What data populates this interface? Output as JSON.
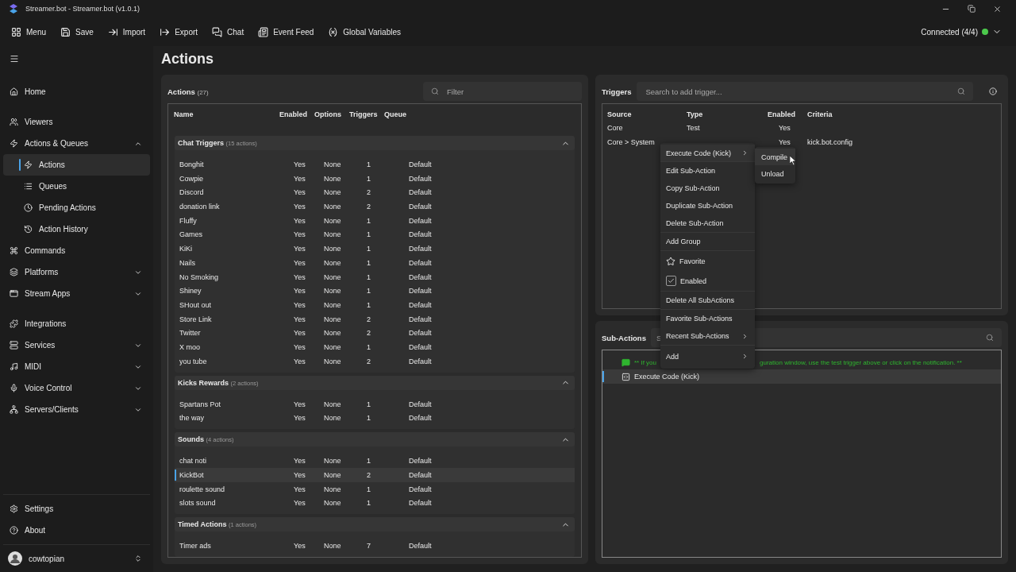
{
  "window": {
    "title": "Streamer.bot - Streamer.bot (v1.0.1)"
  },
  "toolbar": [
    {
      "label": "Menu"
    },
    {
      "label": "Save"
    },
    {
      "label": "Import"
    },
    {
      "label": "Export"
    },
    {
      "label": "Chat"
    },
    {
      "label": "Event Feed"
    },
    {
      "label": "Global Variables"
    }
  ],
  "connection": {
    "label": "Connected (4/4)",
    "connected": true
  },
  "sidebar": {
    "items": [
      {
        "label": "Home"
      },
      {
        "label": "Viewers"
      },
      {
        "label": "Actions & Queues",
        "expanded": true,
        "children": [
          {
            "label": "Actions",
            "selected": true
          },
          {
            "label": "Queues",
            "selected": false
          },
          {
            "label": "Pending Actions",
            "selected": false
          },
          {
            "label": "Action History",
            "selected": false
          }
        ]
      },
      {
        "label": "Commands"
      },
      {
        "label": "Platforms",
        "expanded": false
      },
      {
        "label": "Stream Apps",
        "expanded": false
      },
      {
        "label": "Integrations"
      },
      {
        "label": "Services",
        "expanded": false
      },
      {
        "label": "MIDI",
        "expanded": false
      },
      {
        "label": "Voice Control",
        "expanded": false
      },
      {
        "label": "Servers/Clients",
        "expanded": false
      }
    ],
    "bottom": [
      {
        "label": "Settings"
      },
      {
        "label": "About"
      }
    ],
    "user": {
      "name": "cowtopian"
    }
  },
  "page_title": "Actions",
  "actions_panel": {
    "title": "Actions",
    "count": "(27)",
    "filter_placeholder": "Filter",
    "columns": [
      "Name",
      "Enabled",
      "Options",
      "Triggers",
      "Queue"
    ],
    "groups": [
      {
        "name": "Chat Triggers",
        "count": "(15 actions)",
        "expanded": true,
        "rows": [
          {
            "name": "Bonghit",
            "enabled": "Yes",
            "options": "None",
            "triggers": "1",
            "queue": "Default",
            "selected": false
          },
          {
            "name": "Cowpie",
            "enabled": "Yes",
            "options": "None",
            "triggers": "1",
            "queue": "Default",
            "selected": false
          },
          {
            "name": "Discord",
            "enabled": "Yes",
            "options": "None",
            "triggers": "2",
            "queue": "Default",
            "selected": false
          },
          {
            "name": "donation link",
            "enabled": "Yes",
            "options": "None",
            "triggers": "2",
            "queue": "Default",
            "selected": false
          },
          {
            "name": "Fluffy",
            "enabled": "Yes",
            "options": "None",
            "triggers": "1",
            "queue": "Default",
            "selected": false
          },
          {
            "name": "Games",
            "enabled": "Yes",
            "options": "None",
            "triggers": "1",
            "queue": "Default",
            "selected": false
          },
          {
            "name": "KiKi",
            "enabled": "Yes",
            "options": "None",
            "triggers": "1",
            "queue": "Default",
            "selected": false
          },
          {
            "name": "Nails",
            "enabled": "Yes",
            "options": "None",
            "triggers": "1",
            "queue": "Default",
            "selected": false
          },
          {
            "name": "No Smoking",
            "enabled": "Yes",
            "options": "None",
            "triggers": "1",
            "queue": "Default",
            "selected": false
          },
          {
            "name": "Shiney",
            "enabled": "Yes",
            "options": "None",
            "triggers": "1",
            "queue": "Default",
            "selected": false
          },
          {
            "name": "SHout out",
            "enabled": "Yes",
            "options": "None",
            "triggers": "1",
            "queue": "Default",
            "selected": false
          },
          {
            "name": "Store Link",
            "enabled": "Yes",
            "options": "None",
            "triggers": "2",
            "queue": "Default",
            "selected": false
          },
          {
            "name": "Twitter",
            "enabled": "Yes",
            "options": "None",
            "triggers": "2",
            "queue": "Default",
            "selected": false
          },
          {
            "name": "X moo",
            "enabled": "Yes",
            "options": "None",
            "triggers": "1",
            "queue": "Default",
            "selected": false
          },
          {
            "name": "you tube",
            "enabled": "Yes",
            "options": "None",
            "triggers": "2",
            "queue": "Default",
            "selected": false
          }
        ]
      },
      {
        "name": "Kicks Rewards",
        "count": "(2 actions)",
        "expanded": true,
        "rows": [
          {
            "name": "Spartans Pot",
            "enabled": "Yes",
            "options": "None",
            "triggers": "1",
            "queue": "Default",
            "selected": false
          },
          {
            "name": "the way",
            "enabled": "Yes",
            "options": "None",
            "triggers": "1",
            "queue": "Default",
            "selected": false
          }
        ]
      },
      {
        "name": "Sounds",
        "count": "(4 actions)",
        "expanded": true,
        "rows": [
          {
            "name": "chat noti",
            "enabled": "Yes",
            "options": "None",
            "triggers": "1",
            "queue": "Default",
            "selected": false
          },
          {
            "name": "KickBot",
            "enabled": "Yes",
            "options": "None",
            "triggers": "2",
            "queue": "Default",
            "selected": true
          },
          {
            "name": "roulette sound",
            "enabled": "Yes",
            "options": "None",
            "triggers": "1",
            "queue": "Default",
            "selected": false
          },
          {
            "name": "slots sound",
            "enabled": "Yes",
            "options": "None",
            "triggers": "1",
            "queue": "Default",
            "selected": false
          }
        ]
      },
      {
        "name": "Timed Actions",
        "count": "(1 actions)",
        "expanded": true,
        "rows": [
          {
            "name": "Timer ads",
            "enabled": "Yes",
            "options": "None",
            "triggers": "7",
            "queue": "Default",
            "selected": false
          }
        ]
      }
    ]
  },
  "triggers_panel": {
    "title": "Triggers",
    "search_placeholder": "Search to add trigger...",
    "columns": [
      "Source",
      "Type",
      "Enabled",
      "Criteria"
    ],
    "rows": [
      {
        "source": "Core",
        "type": "Test",
        "enabled": "Yes",
        "criteria": ""
      },
      {
        "source": "Core > System",
        "type": "",
        "enabled": "Yes",
        "criteria": "kick.bot.config"
      }
    ]
  },
  "subactions_panel": {
    "title": "Sub-Actions",
    "search_placeholder": "S",
    "items": [
      {
        "kind": "comment",
        "text_start": "** If you",
        "text_end": "guration window, use the test trigger above or click on the notification. **"
      },
      {
        "kind": "action",
        "label": "Execute Code (Kick)",
        "selected": true
      }
    ]
  },
  "context_menu": {
    "items": [
      {
        "kind": "submenu",
        "label": "Execute Code (Kick)",
        "separator_before": false
      },
      {
        "kind": "item",
        "label": "Edit Sub-Action",
        "separator_before": true
      },
      {
        "kind": "item",
        "label": "Copy Sub-Action",
        "separator_before": false
      },
      {
        "kind": "item",
        "label": "Duplicate Sub-Action",
        "separator_before": false
      },
      {
        "kind": "item",
        "label": "Delete Sub-Action",
        "separator_before": false
      },
      {
        "kind": "item",
        "label": "Add Group",
        "separator_before": true
      },
      {
        "kind": "favorite",
        "label": "Favorite",
        "separator_before": true
      },
      {
        "kind": "check",
        "label": "Enabled",
        "checked": true,
        "separator_before": false
      },
      {
        "kind": "item",
        "label": "Delete All SubActions",
        "separator_before": true
      },
      {
        "kind": "item",
        "label": "Favorite Sub-Actions",
        "separator_before": true
      },
      {
        "kind": "submenu",
        "label": "Recent Sub-Actions",
        "separator_before": false
      },
      {
        "kind": "submenu",
        "label": "Add",
        "separator_before": true
      }
    ],
    "submenu": [
      {
        "label": "Compile",
        "hovered": true
      },
      {
        "label": "Unload",
        "hovered": false
      }
    ]
  }
}
